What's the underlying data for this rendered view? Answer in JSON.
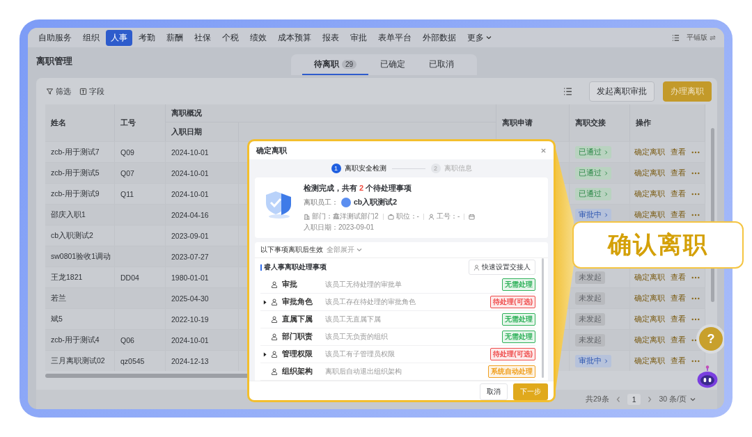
{
  "nav": {
    "items": [
      {
        "label": "自助服务",
        "selected": false
      },
      {
        "label": "组织",
        "selected": false
      },
      {
        "label": "人事",
        "selected": true
      },
      {
        "label": "考勤",
        "selected": false
      },
      {
        "label": "薪酬",
        "selected": false
      },
      {
        "label": "社保",
        "selected": false
      },
      {
        "label": "个税",
        "selected": false
      },
      {
        "label": "绩效",
        "selected": false
      },
      {
        "label": "成本预算",
        "selected": false
      },
      {
        "label": "报表",
        "selected": false
      },
      {
        "label": "审批",
        "selected": false
      },
      {
        "label": "表单平台",
        "selected": false
      },
      {
        "label": "外部数据",
        "selected": false
      }
    ],
    "more": "更多",
    "mode": "平铺版"
  },
  "page": {
    "title": "离职管理",
    "tabs": [
      {
        "label": "待离职",
        "badge": "29",
        "selected": true
      },
      {
        "label": "已确定",
        "selected": false
      },
      {
        "label": "已取消",
        "selected": false
      }
    ]
  },
  "toolbar": {
    "filter": "筛选",
    "fields": "字段",
    "buttons": [
      {
        "label": "发起离职审批",
        "kind": "default"
      },
      {
        "label": "办理离职",
        "kind": "primary"
      }
    ]
  },
  "table": {
    "group_header": "离职概况",
    "columns": {
      "name": "姓名",
      "id": "工号",
      "hire_date": "入职日期",
      "application": "离职申请",
      "handover": "离职交接",
      "actions": "操作"
    },
    "rows": [
      {
        "name": "zcb-用于测试7",
        "id": "Q09",
        "hire_date": "2024-10-01",
        "handover": {
          "label": "已通过",
          "kind": "passed"
        },
        "actions": [
          "确定离职",
          "查看"
        ]
      },
      {
        "name": "zcb-用于测试5",
        "id": "Q07",
        "hire_date": "2024-10-01",
        "handover": {
          "label": "已通过",
          "kind": "passed"
        },
        "actions": [
          "确定离职",
          "查看"
        ]
      },
      {
        "name": "zcb-用于测试9",
        "id": "Q11",
        "hire_date": "2024-10-01",
        "handover": {
          "label": "已通过",
          "kind": "passed"
        },
        "actions": [
          "确定离职",
          "查看"
        ]
      },
      {
        "name": "邵庆入职1",
        "hire_date": "2024-04-16",
        "handover": {
          "label": "审批中",
          "kind": "in_review"
        },
        "actions": [
          "确定离职",
          "查看"
        ]
      },
      {
        "name": "cb入职测试2",
        "hire_date": "2023-09-01"
      },
      {
        "name": "sw0801验收1调动",
        "hire_date": "2023-07-27"
      },
      {
        "name": "王龙1821",
        "id": "DD04",
        "hire_date": "1980-01-01",
        "handover": {
          "label": "未发起",
          "kind": "not_started"
        },
        "actions": [
          "确定离职",
          "查看"
        ]
      },
      {
        "name": "若兰",
        "hire_date": "2025-04-30",
        "handover": {
          "label": "未发起",
          "kind": "not_started"
        },
        "actions": [
          "确定离职",
          "查看"
        ]
      },
      {
        "name": "斌5",
        "hire_date": "2022-10-19",
        "handover": {
          "label": "未发起",
          "kind": "not_started"
        },
        "actions": [
          "确定离职",
          "查看"
        ]
      },
      {
        "name": "zcb-用于测试4",
        "id": "Q06",
        "hire_date": "2024-10-01",
        "handover": {
          "label": "未发起",
          "kind": "not_started"
        },
        "actions": [
          "确定离职",
          "查看"
        ]
      },
      {
        "name": "三月离职测试02",
        "id": "qz0545",
        "hire_date": "2024-12-13",
        "handover": {
          "label": "审批中",
          "kind": "in_review"
        },
        "actions": [
          "确定离职",
          "查看"
        ]
      }
    ]
  },
  "pagination": {
    "total": "共29条",
    "page": "1",
    "page_size": "30 条/页"
  },
  "help": "?",
  "dialog": {
    "title": "确定离职",
    "steps": [
      {
        "number": "1",
        "label": "离职安全检测",
        "selected": true
      },
      {
        "number": "2",
        "label": "离职信息",
        "selected": false
      }
    ],
    "summary": {
      "before": "检测完成，共有 ",
      "count": "2",
      "after": " 个待处理事项"
    },
    "employee_label": "离职员工：",
    "employee_name": "cb入职测试2",
    "details": [
      {
        "kind": "department",
        "text": "部门：鑫洋测试部门2"
      },
      {
        "kind": "position",
        "text": "职位：-"
      },
      {
        "kind": "employee_id",
        "text": "工号：-"
      },
      {
        "kind": "hire_date",
        "text": "入职日期：2023-09-01"
      }
    ],
    "effective_note": "以下事项离职后生效",
    "expand_all": "全部展开",
    "section_title": "睿人事离职处理事项",
    "quick_assign": "快速设置交接人",
    "items": [
      {
        "name": "审批",
        "description": "该员工无待处理的审批单",
        "status": "无需处理",
        "color": "#2fb15a",
        "expandable": false
      },
      {
        "name": "审批角色",
        "description": "该员工存在待处理的审批角色",
        "status": "待处理(可选)",
        "color": "#ef4b4b",
        "expandable": true
      },
      {
        "name": "直属下属",
        "description": "该员工无直属下属",
        "status": "无需处理",
        "color": "#2fb15a",
        "expandable": false
      },
      {
        "name": "部门职责",
        "description": "该员工无负责的组织",
        "status": "无需处理",
        "color": "#2fb15a",
        "expandable": false
      },
      {
        "name": "管理权限",
        "description": "该员工有子管理员权限",
        "status": "待处理(可选)",
        "color": "#ef4b4b",
        "expandable": true
      },
      {
        "name": "组织架构",
        "description": "离职后自动退出组织架构",
        "status": "系统自动处理",
        "color": "#f0a020",
        "expandable": false
      }
    ],
    "buttons": {
      "cancel": "取消",
      "next": "下一步"
    }
  },
  "callout": {
    "text": "确认离职"
  }
}
